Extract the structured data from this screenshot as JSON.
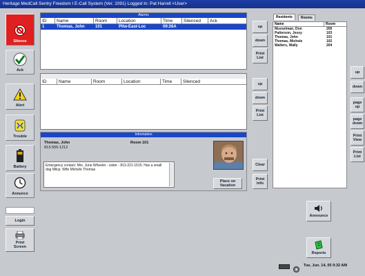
{
  "window": {
    "title": "Heritage MedCall Sentry Freedom I E-Call System (Ver. 1091)  Logged In: Pat Harrell  <User>"
  },
  "left_nav": [
    {
      "label": "Silence",
      "icon": "silence-icon"
    },
    {
      "label": "Ack",
      "icon": "checkmark-icon"
    },
    {
      "label": "Alert",
      "icon": "warning-icon"
    },
    {
      "label": "Trouble",
      "icon": "trouble-icon"
    },
    {
      "label": "Battery",
      "icon": "battery-icon"
    },
    {
      "label": "Annunce",
      "icon": "clock-icon"
    }
  ],
  "login_label": "Login",
  "print_screen_label": "Print Screen",
  "alarms": {
    "title": "Alarms",
    "columns": [
      "ID",
      "Name",
      "Room",
      "Location",
      "Time",
      "Silenced",
      "Ack"
    ],
    "rows": [
      {
        "id": "1",
        "name": "Thomas, John",
        "room": "101",
        "location": "Pllw-East-Loc",
        "time": "09:26A",
        "silenced": "",
        "ack": ""
      }
    ]
  },
  "lower_grid": {
    "title": "",
    "columns": [
      "ID",
      "Name",
      "Room",
      "Location",
      "Time",
      "Silenced"
    ]
  },
  "information": {
    "title": "Information",
    "name": "Thomas, John",
    "room": "Room 101",
    "phone": "813-555-1212",
    "notes": "Emergency contact: Mrs. June Wheeler - sister - 813-221-1515.  Has a small dog Milcp. Wife Michele Thomas",
    "place_on_vacation": "Place on Vacation"
  },
  "mid_buttons": {
    "up": "up",
    "down": "down",
    "print_list": "Print List",
    "up2": "up",
    "down2": "down",
    "print_list2": "Print List",
    "clear": "Clear",
    "print_info": "Print Info"
  },
  "residents": {
    "tabs": [
      "Residents",
      "Rooms"
    ],
    "columns": [
      "Name",
      "Room"
    ],
    "rows": [
      {
        "name": "Musselman, Don",
        "room": "205"
      },
      {
        "name": "Patterson, Jessy",
        "room": "103"
      },
      {
        "name": "Thomas, John",
        "room": "101"
      },
      {
        "name": "Thomas, Michele",
        "room": "102"
      },
      {
        "name": "Walters, Wally",
        "room": "204"
      }
    ]
  },
  "right_buttons": {
    "up": "up",
    "down": "down",
    "page_up": "page up",
    "page_down": "page down",
    "print_view": "Print View",
    "print_list": "Print List"
  },
  "announce_label": "Announce",
  "reports_label": "Reports",
  "status": {
    "datetime": "Tue, Jun. 14, 05 9:32 AM"
  },
  "colors": {
    "title_blue": "#1a47c7",
    "silence_red": "#e02020",
    "background": "#c6c9ce"
  }
}
